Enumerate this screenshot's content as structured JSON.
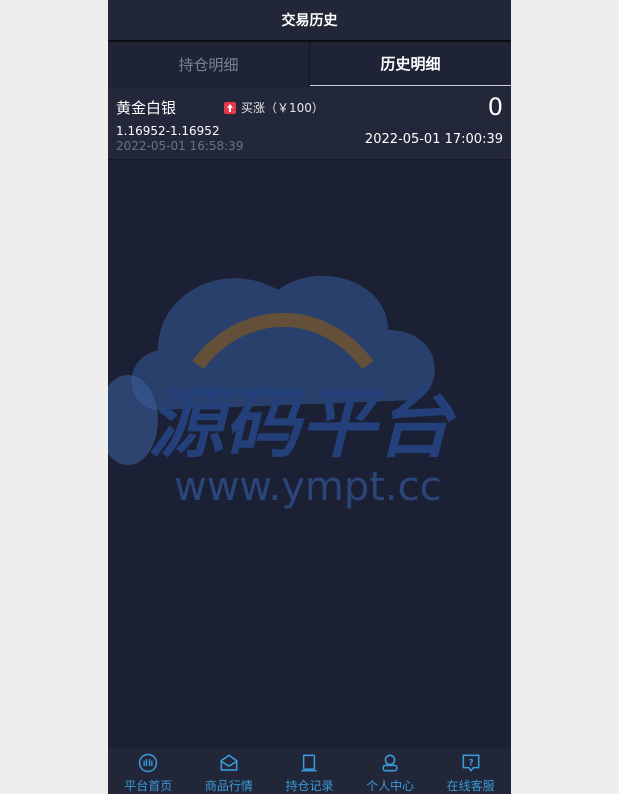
{
  "header": {
    "title": "交易历史"
  },
  "tabs": [
    {
      "label": "持仓明细",
      "active": false
    },
    {
      "label": "历史明细",
      "active": true
    }
  ],
  "records": [
    {
      "name": "黄金白银",
      "direction": "买涨（￥100）",
      "profit": "0",
      "price_range": "1.16952-1.16952",
      "open_time": "2022-05-01 16:58:39",
      "close_time": "2022-05-01 17:00:39"
    }
  ],
  "watermark": {
    "title": "源码平台",
    "url": "www.ympt.cc"
  },
  "nav": [
    {
      "label": "平台首页",
      "icon": "home-icon"
    },
    {
      "label": "商品行情",
      "icon": "market-icon"
    },
    {
      "label": "持仓记录",
      "icon": "position-icon"
    },
    {
      "label": "个人中心",
      "icon": "user-icon"
    },
    {
      "label": "在线客服",
      "icon": "help-icon"
    }
  ],
  "colors": {
    "background": "#1c2034",
    "accent": "#3a9bd8",
    "up": "#e8394c"
  }
}
